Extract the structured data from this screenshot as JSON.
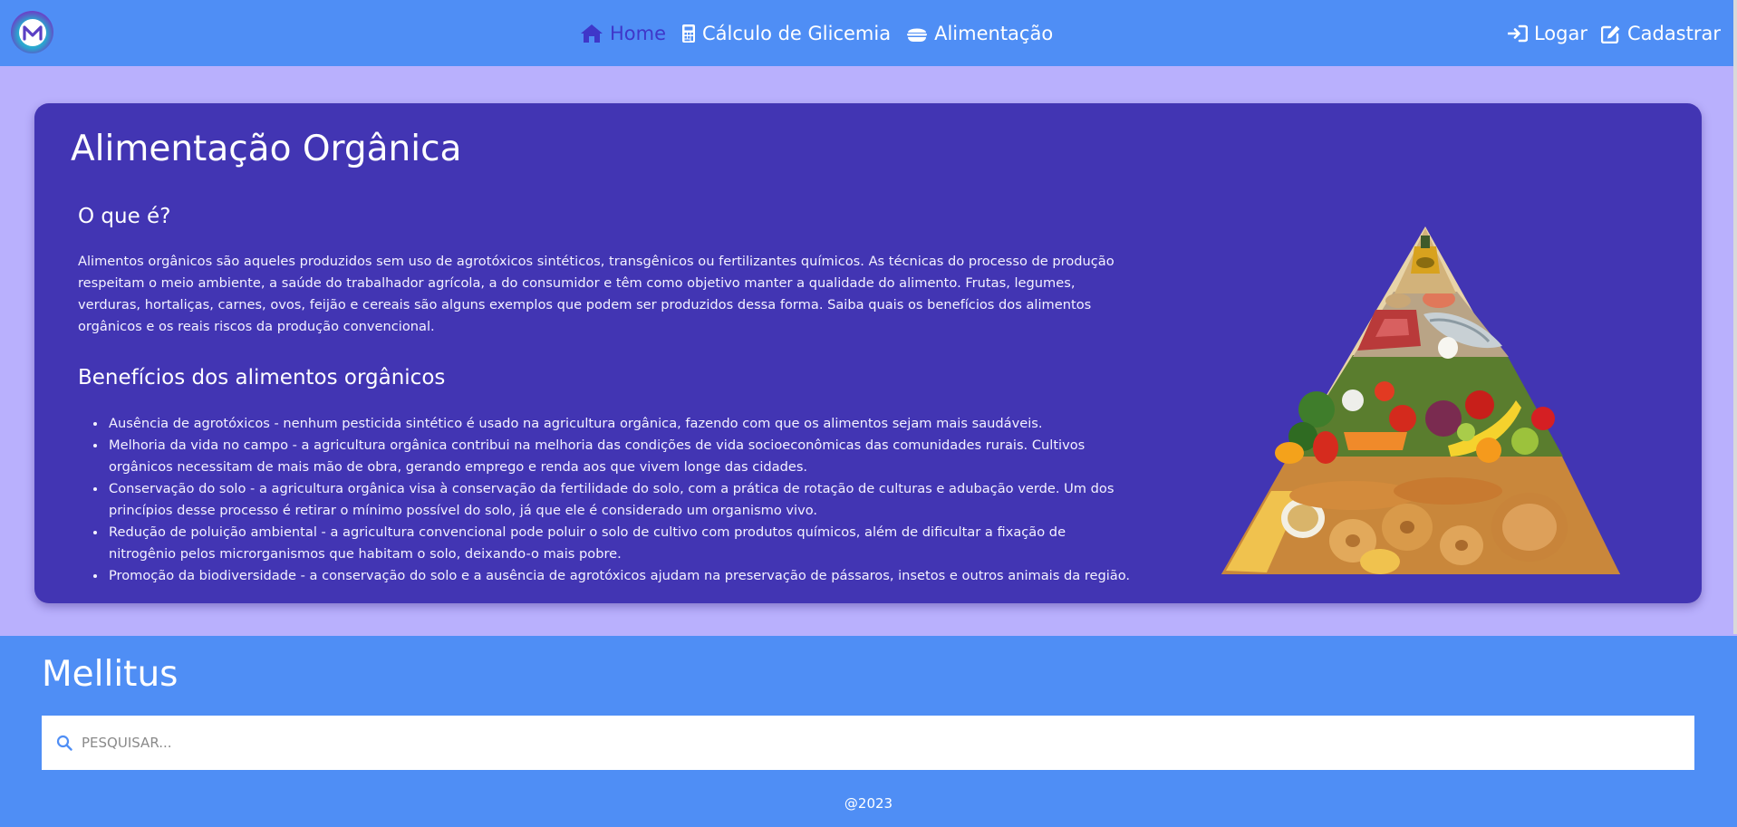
{
  "header": {
    "logo_label": "M",
    "nav": [
      {
        "label": "Home",
        "icon": "home-icon",
        "active": true
      },
      {
        "label": "Cálculo de Glicemia",
        "icon": "calculator-icon",
        "active": false
      },
      {
        "label": "Alimentação",
        "icon": "food-icon",
        "active": false
      }
    ],
    "auth": [
      {
        "label": "Logar",
        "icon": "login-icon"
      },
      {
        "label": "Cadastrar",
        "icon": "edit-icon"
      }
    ]
  },
  "main": {
    "title": "Alimentação Orgânica",
    "what_title": "O que é?",
    "what_text": "Alimentos orgânicos são aqueles produzidos sem uso de agrotóxicos sintéticos, transgênicos ou fertilizantes químicos. As técnicas do processo de produção respeitam o meio ambiente, a saúde do trabalhador agrícola, a do consumidor e têm como objetivo manter a qualidade do alimento. Frutas, legumes, verduras, hortaliças, carnes, ovos, feijão e cereais são alguns exemplos que podem ser produzidos dessa forma. Saiba quais os benefícios dos alimentos orgânicos e os reais riscos da produção convencional.",
    "benefits_title": "Benefícios dos alimentos orgânicos",
    "benefits": [
      "Ausência de agrotóxicos - nenhum pesticida sintético é usado na agricultura orgânica, fazendo com que os alimentos sejam mais saudáveis.",
      "Melhoria da vida no campo - a agricultura orgânica contribui na melhoria das condições de vida socioeconômicas das comunidades rurais. Cultivos orgânicos necessitam de mais mão de obra, gerando emprego e renda aos que vivem longe das cidades.",
      "Conservação do solo - a agricultura orgânica visa à conservação da fertilidade do solo, com a prática de rotação de culturas e adubação verde. Um dos princípios desse processo é retirar o mínimo possível do solo, já que ele é considerado um organismo vivo.",
      "Redução de poluição ambiental - a agricultura convencional pode poluir o solo de cultivo com produtos químicos, além de dificultar a fixação de nitrogênio pelos microrganismos que habitam o solo, deixando-o mais pobre.",
      "Promoção da biodiversidade - a conservação do solo e a ausência de agrotóxicos ajudam na preservação de pássaros, insetos e outros animais da região."
    ]
  },
  "footer": {
    "brand": "Mellitus",
    "search_placeholder": "PESQUISAR...",
    "copyright": "@2023"
  },
  "colors": {
    "navbar": "#4f8ef5",
    "page_bg": "#b9b0fd",
    "card_bg": "#4235b3",
    "active_link": "#3f37c9"
  }
}
